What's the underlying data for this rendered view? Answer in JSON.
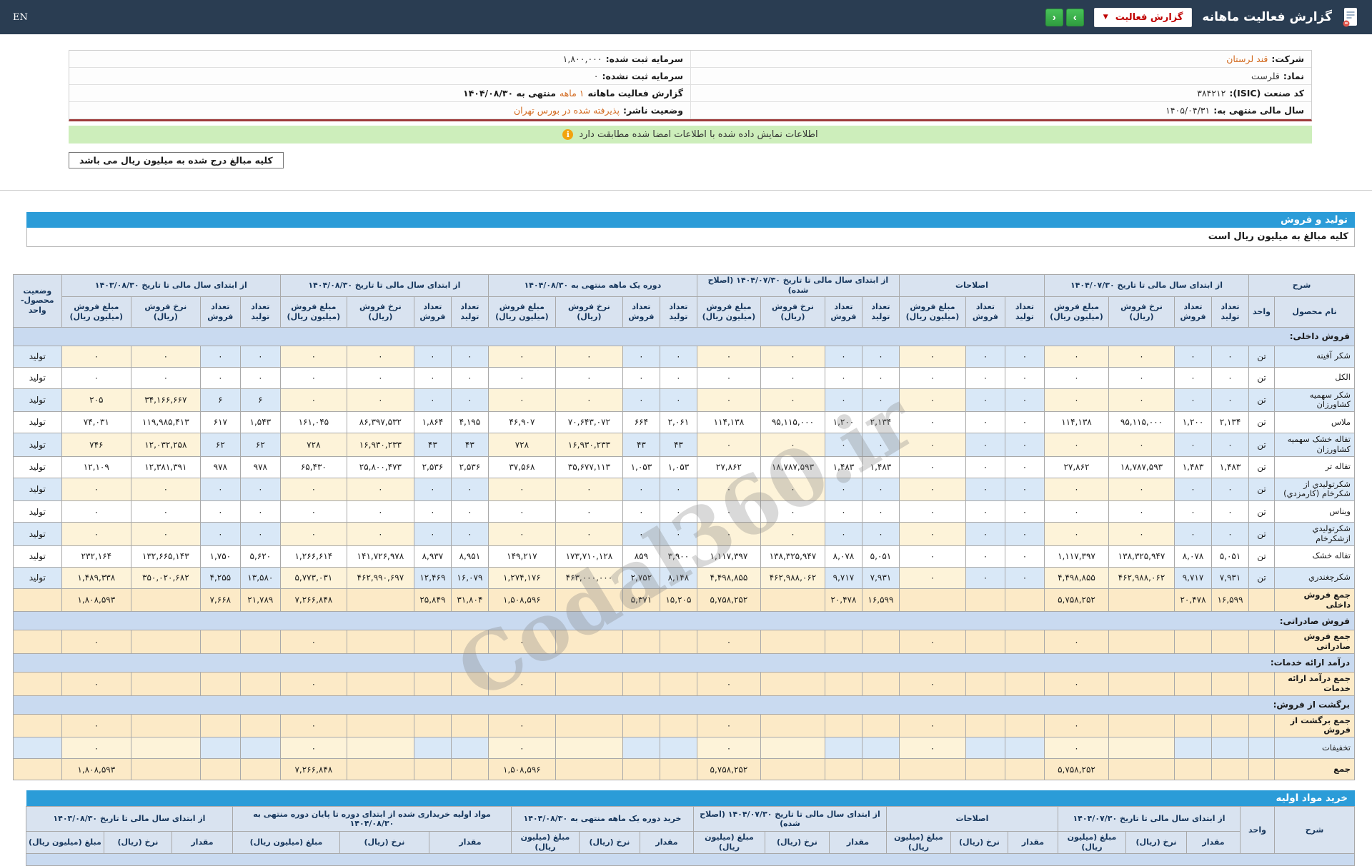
{
  "topbar": {
    "title": "گزارش فعالیت ماهانه",
    "dropdown_label": "گزارش فعالیت",
    "nav_next": "›",
    "nav_prev": "‹",
    "en_label": "EN"
  },
  "info": {
    "right": [
      {
        "label": "شرکت:",
        "value": "قند لرستان",
        "orange": true
      },
      {
        "label": "نماد:",
        "value": "قلرست",
        "orange": false
      },
      {
        "label": "کد صنعت (ISIC):",
        "value": "۳۸۴۲۱۲",
        "orange": false
      },
      {
        "label": "سال مالی منتهی به:",
        "value": "۱۴۰۵/۰۴/۳۱",
        "orange": false
      }
    ],
    "left": [
      {
        "label": "سرمایه ثبت شده:",
        "value": "۱,۸۰۰,۰۰۰",
        "orange": false
      },
      {
        "label": "سرمایه ثبت نشده:",
        "value": "۰",
        "orange": false
      },
      {
        "label": "گزارش فعالیت ماهانه",
        "value": "۱ ماهه",
        "orange": true,
        "suffix": "منتهی به ۱۴۰۴/۰۸/۳۰"
      },
      {
        "label": "وضعیت ناشر:",
        "value": "پذیرفته شده در بورس تهران",
        "orange": true
      }
    ]
  },
  "banner": {
    "text": "اطلاعات نمایش داده شده با اطلاعات امضا شده مطابقت دارد"
  },
  "note_box": "کلیه مبالغ درج شده به میلیون ریال می باشد",
  "section1": {
    "title": "تولید و فروش",
    "subtitle": "کلیه مبالغ به میلیون ریال است"
  },
  "section2": {
    "title": "خرید مواد اولیه"
  },
  "watermark": "Codal360.ir",
  "colors": {
    "topbar_bg": "#2a3d52",
    "section_bar": "#2b9cd8",
    "accent_orange": "#d2691e",
    "accent_red": "#c00000",
    "banner_green": "#cdeebb",
    "green_button": "#39a845",
    "blue_cell": "#d9e8f7",
    "cream_cell": "#fdf3d9",
    "total_cell": "#fceac7"
  },
  "table1": {
    "corner": {
      "sharh": "شرح",
      "name": "نام محصول",
      "unit": "واحد",
      "status": "وضعیت محصول-واحد"
    },
    "groups": [
      {
        "label": "از ابتدای سال مالی تا تاریخ ۱۴۰۴/۰۷/۳۰",
        "cols": 4
      },
      {
        "label": "اصلاحات",
        "cols": 3
      },
      {
        "label": "از ابتدای سال مالی تا تاریخ ۱۴۰۴/۰۷/۳۰ (اصلاح شده)",
        "cols": 4
      },
      {
        "label": "دوره یک ماهه منتهی به ۱۴۰۴/۰۸/۳۰",
        "cols": 4
      },
      {
        "label": "از ابتدای سال مالی تا تاریخ ۱۴۰۴/۰۸/۳۰",
        "cols": 4
      },
      {
        "label": "از ابتدای سال مالی تا تاریخ ۱۴۰۳/۰۸/۳۰",
        "cols": 4
      }
    ],
    "sub_cols": [
      "تعداد تولید",
      "تعداد فروش",
      "نرخ فروش (ریال)",
      "مبلغ فروش (میلیون ریال)"
    ],
    "sub_cols_adj": [
      "تعداد تولید",
      "تعداد فروش",
      "مبلغ فروش (میلیون ریال)"
    ],
    "rows": [
      {
        "type": "section",
        "name": "فروش داخلی:"
      },
      {
        "type": "data",
        "shade": true,
        "name": "شکر آفینه",
        "unit": "تن",
        "status": "تولید",
        "g1": [
          "۰",
          "۰",
          "۰",
          "۰"
        ],
        "adj": [
          "۰",
          "۰",
          "۰"
        ],
        "g3": [
          "۰",
          "۰",
          "۰",
          "۰"
        ],
        "g4": [
          "۰",
          "۰",
          "۰",
          "۰"
        ],
        "g5": [
          "۰",
          "۰",
          "۰",
          "۰"
        ],
        "g6": [
          "۰",
          "۰",
          "۰",
          "۰"
        ]
      },
      {
        "type": "data",
        "shade": false,
        "name": "الکل",
        "unit": "تن",
        "status": "تولید",
        "g1": [
          "۰",
          "۰",
          "۰",
          "۰"
        ],
        "adj": [
          "۰",
          "۰",
          "۰"
        ],
        "g3": [
          "۰",
          "۰",
          "۰",
          "۰"
        ],
        "g4": [
          "۰",
          "۰",
          "۰",
          "۰"
        ],
        "g5": [
          "۰",
          "۰",
          "۰",
          "۰"
        ],
        "g6": [
          "۰",
          "۰",
          "۰",
          "۰"
        ]
      },
      {
        "type": "data",
        "shade": true,
        "name": "شکر سهمیه کشاورزان",
        "unit": "تن",
        "status": "تولید",
        "g1": [
          "۰",
          "۰",
          "۰",
          "۰"
        ],
        "adj": [
          "۰",
          "۰",
          "۰"
        ],
        "g3": [
          "۰",
          "۰",
          "۰",
          "۰"
        ],
        "g4": [
          "۰",
          "۰",
          "۰",
          "۰"
        ],
        "g5": [
          "۰",
          "۰",
          "۰",
          "۰"
        ],
        "g6": [
          "۶",
          "۶",
          "۳۴,۱۶۶,۶۶۷",
          "۲۰۵"
        ]
      },
      {
        "type": "data",
        "shade": false,
        "name": "ملاس",
        "unit": "تن",
        "status": "تولید",
        "g1": [
          "۲,۱۳۴",
          "۱,۲۰۰",
          "۹۵,۱۱۵,۰۰۰",
          "۱۱۴,۱۳۸"
        ],
        "adj": [
          "۰",
          "۰",
          "۰"
        ],
        "g3": [
          "۲,۱۳۴",
          "۱,۲۰۰",
          "۹۵,۱۱۵,۰۰۰",
          "۱۱۴,۱۳۸"
        ],
        "g4": [
          "۲,۰۶۱",
          "۶۶۴",
          "۷۰,۶۴۳,۰۷۲",
          "۴۶,۹۰۷"
        ],
        "g5": [
          "۴,۱۹۵",
          "۱,۸۶۴",
          "۸۶,۳۹۷,۵۳۲",
          "۱۶۱,۰۴۵"
        ],
        "g6": [
          "۱,۵۴۳",
          "۶۱۷",
          "۱۱۹,۹۸۵,۴۱۳",
          "۷۴,۰۳۱"
        ]
      },
      {
        "type": "data",
        "shade": true,
        "name": "تفاله خشک سهمیه کشاورزان",
        "unit": "تن",
        "status": "تولید",
        "g1": [
          "۰",
          "۰",
          "۰",
          "۰"
        ],
        "adj": [
          "۰",
          "۰",
          "۰"
        ],
        "g3": [
          "۰",
          "۰",
          "۰",
          "۰"
        ],
        "g4": [
          "۴۳",
          "۴۳",
          "۱۶,۹۳۰,۲۳۳",
          "۷۲۸"
        ],
        "g5": [
          "۴۳",
          "۴۳",
          "۱۶,۹۳۰,۲۳۳",
          "۷۲۸"
        ],
        "g6": [
          "۶۲",
          "۶۲",
          "۱۲,۰۳۲,۲۵۸",
          "۷۴۶"
        ]
      },
      {
        "type": "data",
        "shade": false,
        "name": "تفاله تر",
        "unit": "تن",
        "status": "تولید",
        "g1": [
          "۱,۴۸۳",
          "۱,۴۸۳",
          "۱۸,۷۸۷,۵۹۳",
          "۲۷,۸۶۲"
        ],
        "adj": [
          "۰",
          "۰",
          "۰"
        ],
        "g3": [
          "۱,۴۸۳",
          "۱,۴۸۳",
          "۱۸,۷۸۷,۵۹۳",
          "۲۷,۸۶۲"
        ],
        "g4": [
          "۱,۰۵۳",
          "۱,۰۵۳",
          "۳۵,۶۷۷,۱۱۳",
          "۳۷,۵۶۸"
        ],
        "g5": [
          "۲,۵۳۶",
          "۲,۵۳۶",
          "۲۵,۸۰۰,۴۷۳",
          "۶۵,۴۳۰"
        ],
        "g6": [
          "۹۷۸",
          "۹۷۸",
          "۱۲,۳۸۱,۳۹۱",
          "۱۲,۱۰۹"
        ]
      },
      {
        "type": "data",
        "shade": true,
        "name": "شکرتولیدي از شکرخام (کارمزدي)",
        "unit": "تن",
        "status": "تولید",
        "g1": [
          "۰",
          "۰",
          "۰",
          "۰"
        ],
        "adj": [
          "۰",
          "۰",
          "۰"
        ],
        "g3": [
          "۰",
          "۰",
          "۰",
          "۰"
        ],
        "g4": [
          "۰",
          "۰",
          "۰",
          "۰"
        ],
        "g5": [
          "۰",
          "۰",
          "۰",
          "۰"
        ],
        "g6": [
          "۰",
          "۰",
          "۰",
          "۰"
        ]
      },
      {
        "type": "data",
        "shade": false,
        "name": "ویناس",
        "unit": "تن",
        "status": "تولید",
        "g1": [
          "۰",
          "۰",
          "۰",
          "۰"
        ],
        "adj": [
          "۰",
          "۰",
          "۰"
        ],
        "g3": [
          "۰",
          "۰",
          "۰",
          "۰"
        ],
        "g4": [
          "۰",
          "۰",
          "۰",
          "۰"
        ],
        "g5": [
          "۰",
          "۰",
          "۰",
          "۰"
        ],
        "g6": [
          "۰",
          "۰",
          "۰",
          "۰"
        ]
      },
      {
        "type": "data",
        "shade": true,
        "name": "شکرتولیدي ازشکرخام",
        "unit": "تن",
        "status": "تولید",
        "g1": [
          "۰",
          "۰",
          "۰",
          "۰"
        ],
        "adj": [
          "۰",
          "۰",
          "۰"
        ],
        "g3": [
          "۰",
          "۰",
          "۰",
          "۰"
        ],
        "g4": [
          "۰",
          "۰",
          "۰",
          "۰"
        ],
        "g5": [
          "۰",
          "۰",
          "۰",
          "۰"
        ],
        "g6": [
          "۰",
          "۰",
          "۰",
          "۰"
        ]
      },
      {
        "type": "data",
        "shade": false,
        "name": "تفاله خشک",
        "unit": "تن",
        "status": "تولید",
        "g1": [
          "۵,۰۵۱",
          "۸,۰۷۸",
          "۱۳۸,۳۲۵,۹۴۷",
          "۱,۱۱۷,۳۹۷"
        ],
        "adj": [
          "۰",
          "۰",
          "۰"
        ],
        "g3": [
          "۵,۰۵۱",
          "۸,۰۷۸",
          "۱۳۸,۳۲۵,۹۴۷",
          "۱,۱۱۷,۳۹۷"
        ],
        "g4": [
          "۳,۹۰۰",
          "۸۵۹",
          "۱۷۳,۷۱۰,۱۲۸",
          "۱۴۹,۲۱۷"
        ],
        "g5": [
          "۸,۹۵۱",
          "۸,۹۳۷",
          "۱۴۱,۷۲۶,۹۷۸",
          "۱,۲۶۶,۶۱۴"
        ],
        "g6": [
          "۵,۶۲۰",
          "۱,۷۵۰",
          "۱۳۲,۶۶۵,۱۴۳",
          "۲۳۲,۱۶۴"
        ]
      },
      {
        "type": "data",
        "shade": true,
        "name": "شکرچغندري",
        "unit": "تن",
        "status": "تولید",
        "g1": [
          "۷,۹۳۱",
          "۹,۷۱۷",
          "۴۶۲,۹۸۸,۰۶۲",
          "۴,۴۹۸,۸۵۵"
        ],
        "adj": [
          "۰",
          "۰",
          "۰"
        ],
        "g3": [
          "۷,۹۳۱",
          "۹,۷۱۷",
          "۴۶۲,۹۸۸,۰۶۲",
          "۴,۴۹۸,۸۵۵"
        ],
        "g4": [
          "۸,۱۴۸",
          "۲,۷۵۲",
          "۴۶۳,۰۰۰,۰۰۰",
          "۱,۲۷۴,۱۷۶"
        ],
        "g5": [
          "۱۶,۰۷۹",
          "۱۲,۴۶۹",
          "۴۶۲,۹۹۰,۶۹۷",
          "۵,۷۷۳,۰۳۱"
        ],
        "g6": [
          "۱۳,۵۸۰",
          "۴,۲۵۵",
          "۳۵۰,۰۲۰,۶۸۲",
          "۱,۴۸۹,۳۳۸"
        ]
      },
      {
        "type": "total",
        "name": "جمع فروش داخلی",
        "g1": [
          "۱۶,۵۹۹",
          "۲۰,۴۷۸",
          "",
          "۵,۷۵۸,۲۵۲"
        ],
        "adj": [
          "",
          "",
          ""
        ],
        "g3": [
          "۱۶,۵۹۹",
          "۲۰,۴۷۸",
          "",
          "۵,۷۵۸,۲۵۲"
        ],
        "g4": [
          "۱۵,۲۰۵",
          "۵,۳۷۱",
          "",
          "۱,۵۰۸,۵۹۶"
        ],
        "g5": [
          "۳۱,۸۰۴",
          "۲۵,۸۴۹",
          "",
          "۷,۲۶۶,۸۴۸"
        ],
        "g6": [
          "۲۱,۷۸۹",
          "۷,۶۶۸",
          "",
          "۱,۸۰۸,۵۹۳"
        ]
      },
      {
        "type": "section",
        "name": "فروش صادراتی:"
      },
      {
        "type": "total",
        "name": "جمع فروش صادراتی",
        "g1": [
          "",
          "",
          "",
          "۰"
        ],
        "adj": [
          "",
          "",
          "۰"
        ],
        "g3": [
          "",
          "",
          "",
          "۰"
        ],
        "g4": [
          "",
          "",
          "",
          "۰"
        ],
        "g5": [
          "",
          "",
          "",
          "۰"
        ],
        "g6": [
          "",
          "",
          "",
          "۰"
        ]
      },
      {
        "type": "section",
        "name": "درآمد ارائه خدمات:"
      },
      {
        "type": "total",
        "name": "جمع درآمد ارائه خدمات",
        "g1": [
          "",
          "",
          "",
          "۰"
        ],
        "adj": [
          "",
          "",
          "۰"
        ],
        "g3": [
          "",
          "",
          "",
          "۰"
        ],
        "g4": [
          "",
          "",
          "",
          "۰"
        ],
        "g5": [
          "",
          "",
          "",
          "۰"
        ],
        "g6": [
          "",
          "",
          "",
          "۰"
        ]
      },
      {
        "type": "section",
        "name": "برگشت از فروش:"
      },
      {
        "type": "total",
        "name": "جمع برگشت از فروش",
        "g1": [
          "",
          "",
          "",
          "۰"
        ],
        "adj": [
          "",
          "",
          "۰"
        ],
        "g3": [
          "",
          "",
          "",
          "۰"
        ],
        "g4": [
          "",
          "",
          "",
          "۰"
        ],
        "g5": [
          "",
          "",
          "",
          "۰"
        ],
        "g6": [
          "",
          "",
          "",
          "۰"
        ]
      },
      {
        "type": "data",
        "shade": true,
        "name": "تخفیفات",
        "unit": "",
        "status": "",
        "g1": [
          "",
          "",
          "",
          "۰"
        ],
        "adj": [
          "",
          "",
          "۰"
        ],
        "g3": [
          "",
          "",
          "",
          "۰"
        ],
        "g4": [
          "",
          "",
          "",
          "۰"
        ],
        "g5": [
          "",
          "",
          "",
          "۰"
        ],
        "g6": [
          "",
          "",
          "",
          "۰"
        ]
      },
      {
        "type": "total",
        "name": "جمع",
        "g1": [
          "",
          "",
          "",
          "۵,۷۵۸,۲۵۲"
        ],
        "adj": [
          "",
          "",
          ""
        ],
        "g3": [
          "",
          "",
          "",
          "۵,۷۵۸,۲۵۲"
        ],
        "g4": [
          "",
          "",
          "",
          "۱,۵۰۸,۵۹۶"
        ],
        "g5": [
          "",
          "",
          "",
          "۷,۲۶۶,۸۴۸"
        ],
        "g6": [
          "",
          "",
          "",
          "۱,۸۰۸,۵۹۳"
        ]
      }
    ]
  },
  "table2": {
    "corner": {
      "sharh": "شرح",
      "unit": "واحد"
    },
    "groups": [
      {
        "label": "از ابتدای سال مالی تا تاریخ ۱۴۰۴/۰۷/۳۰",
        "cols": 3
      },
      {
        "label": "اصلاحات",
        "cols": 3
      },
      {
        "label": "از ابتدای سال مالی تا تاریخ ۱۴۰۴/۰۷/۳۰ (اصلاح شده)",
        "cols": 3
      },
      {
        "label": "خرید دوره یک ماهه منتهی به ۱۴۰۴/۰۸/۳۰",
        "cols": 3
      },
      {
        "label": "مواد اولیه خریداری شده از ابتدای دوره تا پایان دوره منتهی به ۱۴۰۴/۰۸/۳۰",
        "cols": 3
      },
      {
        "label": "از ابتدای سال مالی تا تاریخ ۱۴۰۳/۰۸/۳۰",
        "cols": 3
      }
    ],
    "sub_cols": [
      "مقدار",
      "نرخ (ریال)",
      "مبلغ (میلیون ریال)"
    ],
    "rows": [
      {
        "type": "section",
        "name": ""
      }
    ]
  }
}
